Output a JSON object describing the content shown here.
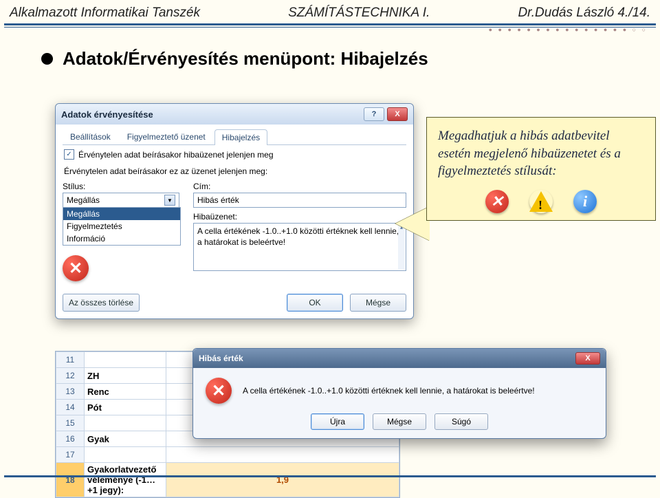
{
  "header": {
    "left": "Alkalmazott Informatikai Tanszék",
    "center": "SZÁMÍTÁSTECHNIKA I.",
    "right": "Dr.Dudás László  4./14."
  },
  "title": "Adatok/Érvényesítés menüpont: Hibajelzés",
  "dialog": {
    "title": "Adatok érvényesítése",
    "help": "?",
    "close": "X",
    "tabs": [
      "Beállítások",
      "Figyelmeztető üzenet",
      "Hibajelzés"
    ],
    "checkbox_label": "Érvénytelen adat beírásakor hibaüzenet jelenjen meg",
    "prompt": "Érvénytelen adat beírásakor ez az üzenet jelenjen meg:",
    "style_label": "Stílus:",
    "style_value": "Megállás",
    "style_options": [
      "Megállás",
      "Figyelmeztetés",
      "Információ"
    ],
    "title_label": "Cím:",
    "title_value": "Hibás érték",
    "msg_label": "Hibaüzenet:",
    "msg_value": "A cella értékének -1.0..+1.0 közötti értéknek kell lennie, a határokat is beleértve!",
    "btn_clear": "Az összes törlése",
    "btn_ok": "OK",
    "btn_cancel": "Mégse"
  },
  "callout": {
    "text": "Megadhatjuk a hibás adatbevitel esetén megjelenő hibaüzenetet és a figyelmeztetés stílusát:"
  },
  "sheet": {
    "rows": [
      {
        "n": "11",
        "b": "",
        "c": ""
      },
      {
        "n": "12",
        "b": "ZH",
        "c": ""
      },
      {
        "n": "13",
        "b": "Renc",
        "c": ""
      },
      {
        "n": "14",
        "b": "Pót",
        "c": ""
      },
      {
        "n": "15",
        "b": "",
        "c": ""
      },
      {
        "n": "16",
        "b": "Gyak",
        "c": ""
      },
      {
        "n": "17",
        "b": "",
        "c": ""
      }
    ],
    "sel_n": "18",
    "sel_b": "Gyakorlatvezető véleménye (-1…+1 jegy):",
    "sel_c": "1,9"
  },
  "msgbox": {
    "title": "Hibás érték",
    "text": "A cella értékének -1.0..+1.0 közötti értéknek kell lennie, a határokat is beleértve!",
    "btn_retry": "Újra",
    "btn_cancel": "Mégse",
    "btn_help": "Súgó",
    "close": "X"
  }
}
